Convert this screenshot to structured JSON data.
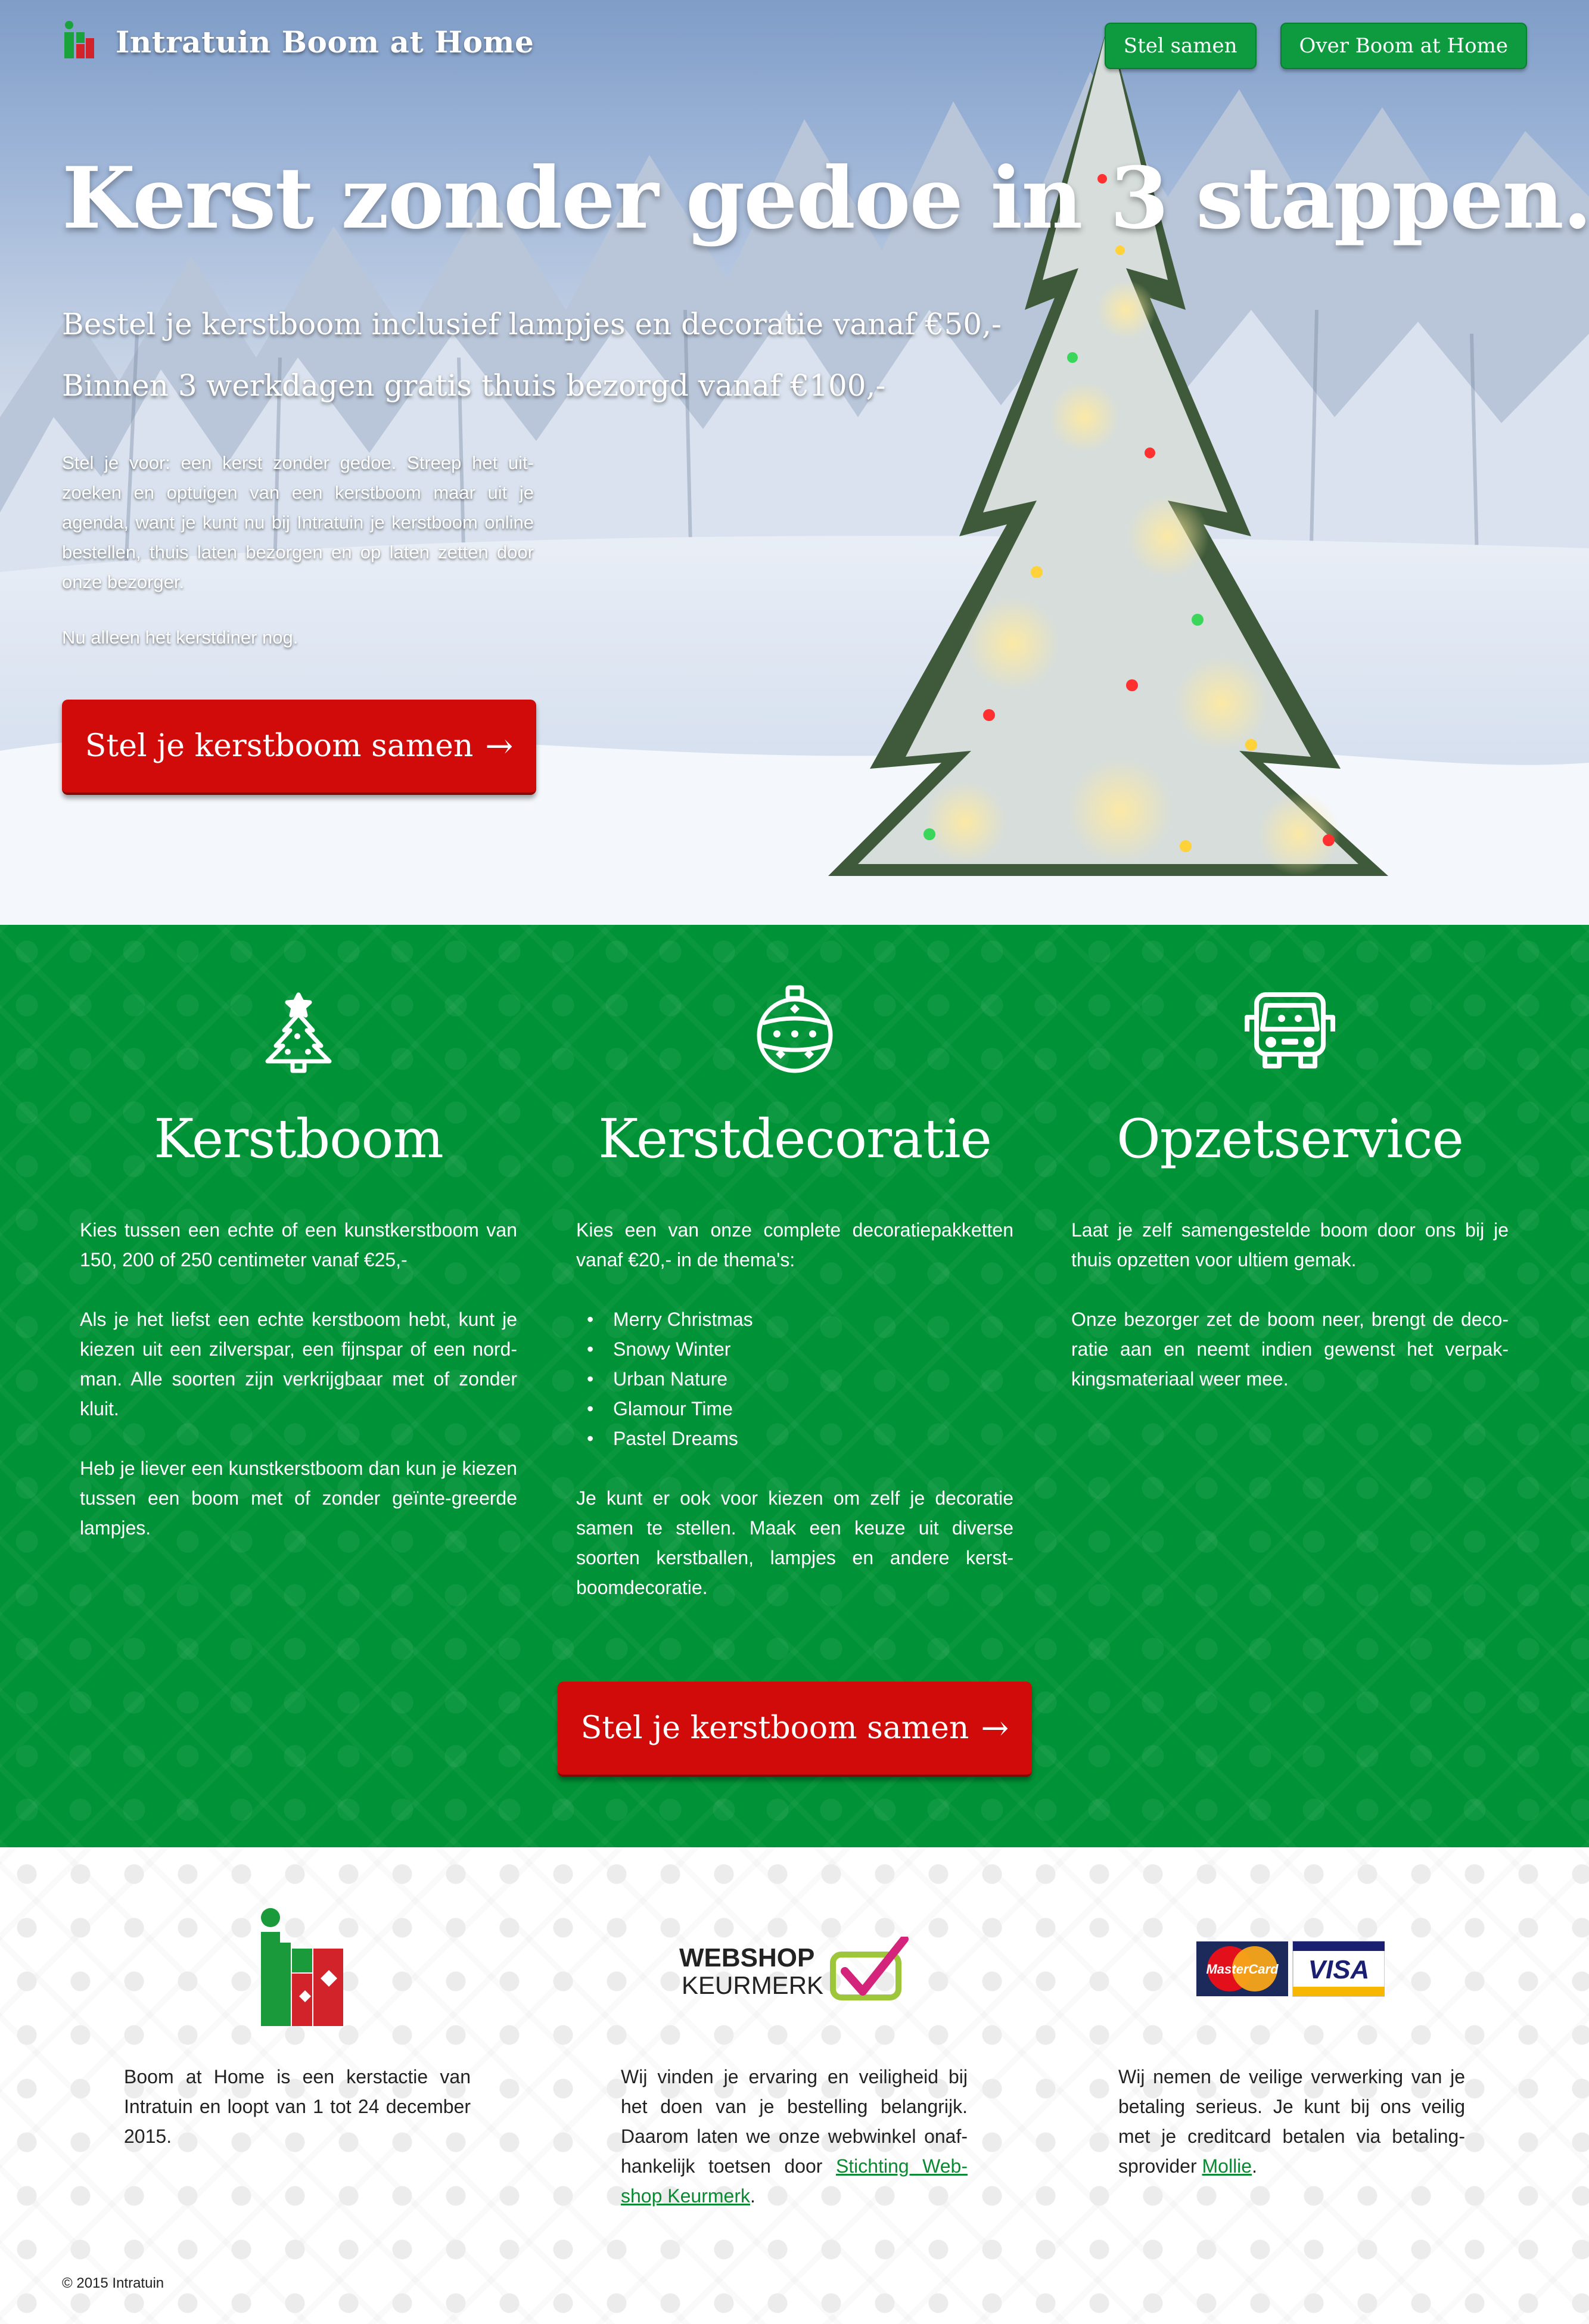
{
  "header": {
    "brand_name": "Intratuin Boom at Home",
    "nav": [
      {
        "label": "Stel samen"
      },
      {
        "label": "Over Boom at Home"
      }
    ]
  },
  "hero": {
    "title": "Kerst zonder gedoe in 3 stappen.",
    "subtitle_1": "Bestel je kerstboom inclusief lampjes en decoratie vanaf €50,-",
    "subtitle_2": "Binnen 3 werkdagen gratis thuis bezorgd vanaf €100,-",
    "text": "Stel je voor: een kerst zonder gedoe. Streep het uit-zoeken en optuigen van een kerstboom maar uit je agenda, want je kunt nu bij Intratuin je kerstboom online bestellen, thuis laten bezorgen en op laten zetten door onze bezorger.",
    "text_2": "Nu alleen het kerstdiner nog.",
    "cta_label": "Stel je kerstboom samen",
    "cta_arrow": "→"
  },
  "features": {
    "kerstboom": {
      "title": "Kerstboom",
      "p1": "Kies tussen een echte of een kunstkerstboom van 150, 200 of 250 centimeter vanaf €25,-",
      "p2": "Als je het liefst een echte kerstboom hebt, kunt je kiezen uit een zilverspar, een fijnspar of een nord-man. Alle soorten zijn verkrijgbaar met of zonder kluit.",
      "p3": "Heb je liever een kunstkerstboom dan kun je kiezen tussen een boom met of zonder geïnte-greerde lampjes."
    },
    "kerstdecoratie": {
      "title": "Kerstdecoratie",
      "p1": "Kies een van onze complete decoratiepakketten vanaf €20,- in de thema's:",
      "themes": [
        "Merry Christmas",
        "Snowy Winter",
        "Urban Nature",
        "Glamour Time",
        "Pastel Dreams"
      ],
      "p2": "Je kunt er ook voor kiezen om zelf je decoratie samen te stellen. Maak een keuze uit diverse soorten kerstballen, lampjes en andere kerst-boomdecoratie."
    },
    "opzetservice": {
      "title": "Opzetservice",
      "p1": "Laat je zelf samengestelde boom door ons bij je thuis opzetten voor ultiem gemak.",
      "p2": "Onze bezorger zet de boom neer, brengt de deco-ratie aan en neemt indien gewenst het verpak-kingsmateriaal weer mee."
    },
    "cta_label": "Stel je kerstboom samen",
    "cta_arrow": "→"
  },
  "footer": {
    "col1": "Boom at Home is een kerstactie van Intratuin en loopt van 1 tot 24 december 2015.",
    "col2_text": "Wij vinden je ervaring en veiligheid bij het doen van je bestelling belangrijk. Daarom laten we onze webwinkel onaf-hankelijk toetsen door ",
    "col2_link": "Stichting Web-shop Keurmerk",
    "col2_end": ".",
    "col3_text": "Wij nemen de veilige verwerking van je betaling serieus. Je kunt bij ons veilig met je creditcard betalen via betaling-sprovider ",
    "col3_link": "Mollie",
    "col3_end": ".",
    "keurmerk_line1": "WEBSHOP",
    "keurmerk_line2": "KEURMERK",
    "mastercard_label": "MasterCard",
    "visa_label": "VISA",
    "copyright": "© 2015 Intratuin"
  },
  "colors": {
    "green": "#009236",
    "red_cta": "#d10a0a",
    "nav_green": "#0e9a3e",
    "link_green": "#0a8a33"
  },
  "icons": [
    "intratuin-logo-icon",
    "christmas-tree-icon",
    "christmas-bauble-icon",
    "delivery-truck-icon",
    "webshop-keurmerk-logo",
    "mastercard-logo",
    "visa-logo"
  ]
}
